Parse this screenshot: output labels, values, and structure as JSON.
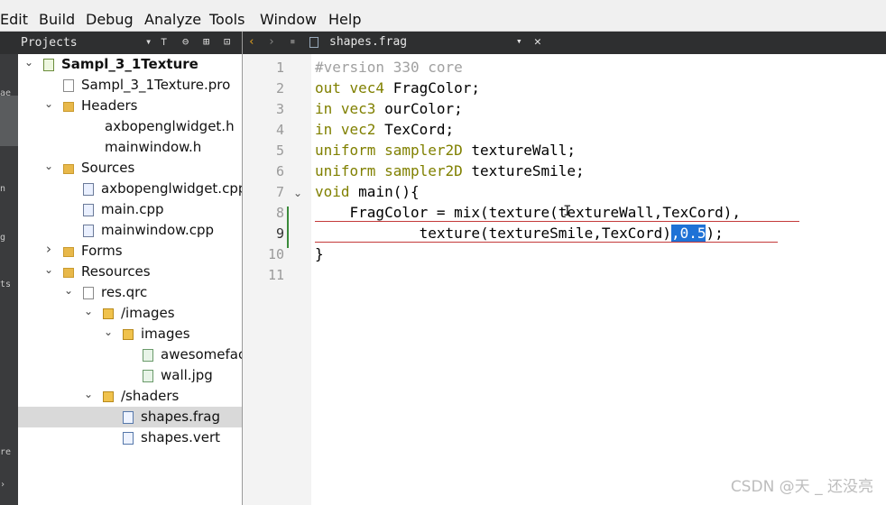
{
  "menu": [
    "Edit",
    "Build",
    "Debug",
    "Analyze",
    "Tools",
    "Window",
    "Help"
  ],
  "projects_pane": {
    "title": "Projects",
    "icons": [
      "dropdown-icon",
      "filter-icon",
      "link-icon",
      "split-icon",
      "close-pane-icon"
    ]
  },
  "editor_tab": {
    "filename": "shapes.frag",
    "icons": [
      "back-icon",
      "forward-icon",
      "lock-icon",
      "file-icon",
      "dropdown-icon",
      "close-icon"
    ]
  },
  "left_rail_labels": [
    "ae",
    "n",
    "g",
    "ts",
    "re"
  ],
  "tree": [
    {
      "label": "Sampl_3_1Texture",
      "arrow": "v",
      "icon": "proj",
      "bold": true
    },
    {
      "label": "Sampl_3_1Texture.pro",
      "arrow": "",
      "icon": "file"
    },
    {
      "label": "Headers",
      "arrow": "v",
      "icon": "folder"
    },
    {
      "label": "axbopenglwidget.h",
      "arrow": "",
      "icon": ""
    },
    {
      "label": "mainwindow.h",
      "arrow": "",
      "icon": ""
    },
    {
      "label": "Sources",
      "arrow": "v",
      "icon": "folder"
    },
    {
      "label": "axbopenglwidget.cpp",
      "arrow": "",
      "icon": "cpp"
    },
    {
      "label": "main.cpp",
      "arrow": "",
      "icon": "cpp"
    },
    {
      "label": "mainwindow.cpp",
      "arrow": "",
      "icon": "cpp"
    },
    {
      "label": "Forms",
      "arrow": ">",
      "icon": "folder"
    },
    {
      "label": "Resources",
      "arrow": "v",
      "icon": "folder"
    },
    {
      "label": "res.qrc",
      "arrow": "v",
      "icon": "file"
    },
    {
      "label": "/images",
      "arrow": "v",
      "icon": "folder-dark"
    },
    {
      "label": "images",
      "arrow": "v",
      "icon": "folder-dark"
    },
    {
      "label": "awesomefac",
      "arrow": "",
      "icon": "img"
    },
    {
      "label": "wall.jpg",
      "arrow": "",
      "icon": "img"
    },
    {
      "label": "/shaders",
      "arrow": "v",
      "icon": "folder-dark"
    },
    {
      "label": "shapes.frag",
      "arrow": "",
      "icon": "gl",
      "selected": true
    },
    {
      "label": "shapes.vert",
      "arrow": "",
      "icon": "gl"
    }
  ],
  "code": {
    "line_numbers": [
      "1",
      "2",
      "3",
      "4",
      "5",
      "6",
      "7",
      "8",
      "9",
      "10",
      "11"
    ],
    "current_line": 9,
    "lines": [
      [
        {
          "t": "#version 330 core",
          "c": "cm"
        }
      ],
      [
        {
          "t": "out vec4 ",
          "c": "k1"
        },
        {
          "t": "FragColor;"
        }
      ],
      [
        {
          "t": "in vec3 ",
          "c": "k1"
        },
        {
          "t": "ourColor;"
        }
      ],
      [
        {
          "t": "in vec2 ",
          "c": "k1"
        },
        {
          "t": "TexCord;"
        }
      ],
      [
        {
          "t": "uniform sampler2D ",
          "c": "k1"
        },
        {
          "t": "textureWall;"
        }
      ],
      [
        {
          "t": "uniform sampler2D ",
          "c": "k1"
        },
        {
          "t": "textureSmile;"
        }
      ],
      [
        {
          "t": "void ",
          "c": "k1"
        },
        {
          "t": "main(){"
        }
      ],
      [
        {
          "t": "    FragColor = mix(texture(textureWall,TexCord),"
        }
      ],
      [
        {
          "t": "            texture(textureSmile,TexCord)"
        },
        {
          "t": ",0.5",
          "c": "sel"
        },
        {
          "t": ");"
        }
      ],
      [
        {
          "t": "}"
        }
      ],
      []
    ]
  },
  "watermark": "CSDN @天 _ 还没亮",
  "colors": {
    "dark_toolbar": "#2e2f30",
    "keyword": "#808000",
    "comment": "#a0a0a0",
    "selection": "#1e72d6",
    "error_underline": "#c43a3a",
    "change_bar": "#3a8a3a"
  }
}
